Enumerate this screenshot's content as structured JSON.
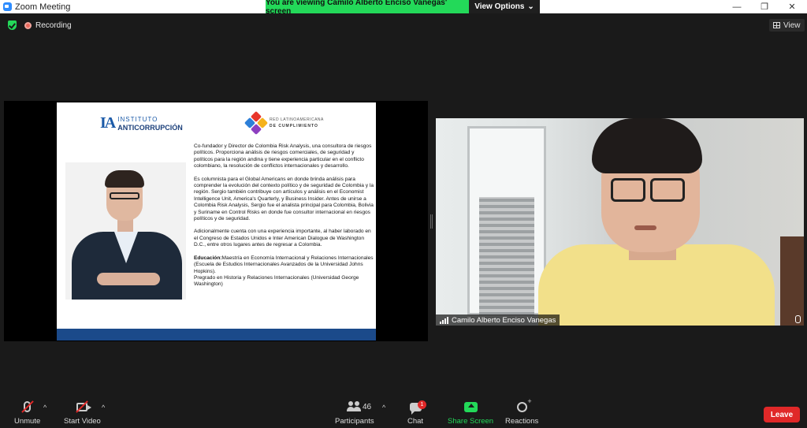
{
  "window": {
    "title": "Zoom Meeting",
    "minimize": "—",
    "restore": "❐",
    "close": "✕"
  },
  "share_banner": {
    "text": "You are viewing Camilo Alberto Enciso Vanegas' screen",
    "view_options": "View Options",
    "view_options_caret": "⌄"
  },
  "status": {
    "recording": "Recording",
    "view": "View"
  },
  "slide": {
    "logo1_mark": "IA",
    "logo1_top": "INSTITUTO",
    "logo1_bottom": "ANTICORRUPCIÓN",
    "logo2_top": "RED LATINOAMERICANA",
    "logo2_bottom": "DE CUMPLIMIENTO",
    "bio_p1": "Co-fundador y Director de Colombia Risk Analysis, una consultora de riesgos políticos. Proporciona análisis de riesgos comerciales, de seguridad y políticos para la región andina y tiene experiencia particular en el conflicto colombiano, la resolución de conflictos internacionales y desarrollo.",
    "bio_p2": "Es columnista para el Global Americans en donde brinda análisis para comprender la evolución del contexto político y de seguridad de Colombia y la región. Sergio también contribuye con artículos y análisis en el Economist Intelligence Unit, America's Quarterly, y Business Insider. Antes de unirse a Colombia Risk Analysis, Sergio fue el analista principal para Colombia, Bolivia y Suriname en Control Risks en donde fue consultor internacional en riesgos políticos y de seguridad.",
    "bio_p3": "Adicionalmente cuenta con una experiencia importante, al haber laborado en el Congreso de Estados Unidos e Inter American Dialogue de Washington D.C., entre otros lugares antes de regresar a Colombia.",
    "edu_label": "Educación:",
    "edu_text": "Maestría en Economía Internacional y Relaciones Internacionales (Escuela de Estudios Internacionales Avanzados de la Universidad Johns Hopkins).",
    "edu_text2": "Pregrado en Historia y Relaciones Internacionales (Universidad George Washington)"
  },
  "video": {
    "participant_name": "Camilo Alberto Enciso Vanegas"
  },
  "toolbar": {
    "unmute": "Unmute",
    "start_video": "Start Video",
    "participants": "Participants",
    "participants_count": "46",
    "chat": "Chat",
    "chat_badge": "1",
    "share_screen": "Share Screen",
    "reactions": "Reactions",
    "leave": "Leave",
    "caret": "^"
  },
  "colors": {
    "accent_green": "#23d959",
    "leave_red": "#e02828",
    "zoom_blue": "#2d8cff"
  }
}
